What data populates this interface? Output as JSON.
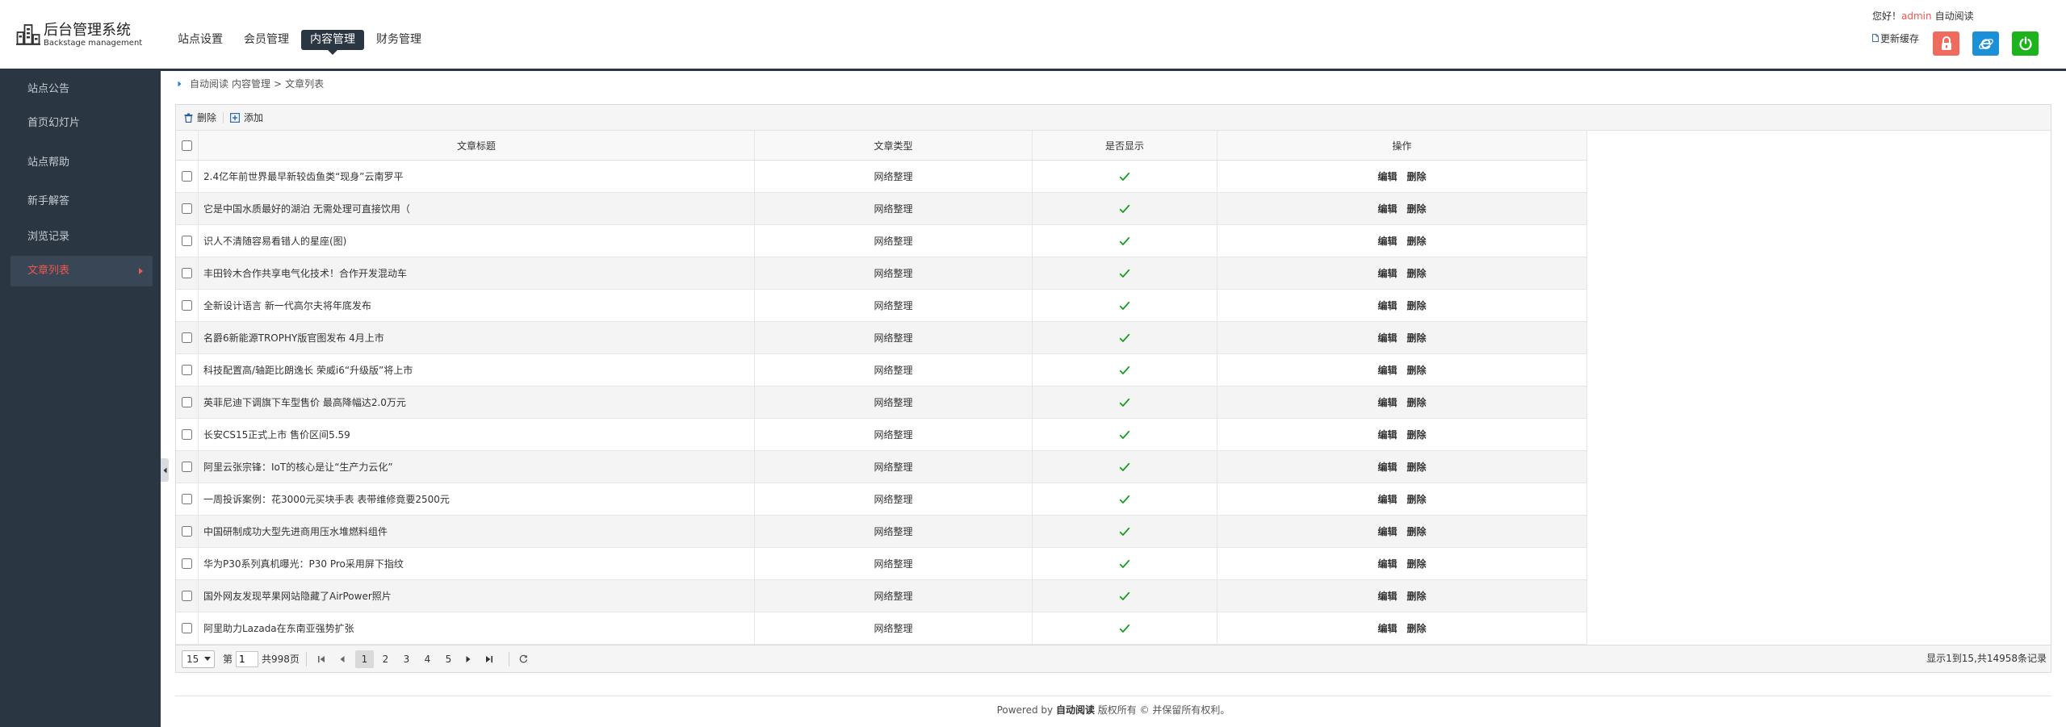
{
  "app": {
    "title": "后台管理系统",
    "subtitle": "Backstage management"
  },
  "nav": {
    "items": [
      {
        "label": "站点设置"
      },
      {
        "label": "会员管理"
      },
      {
        "label": "内容管理",
        "active": true
      },
      {
        "label": "财务管理"
      }
    ]
  },
  "user": {
    "greeting": "您好！",
    "name": "admin",
    "site": "自动阅读",
    "refresh_cache_label": "更新缓存"
  },
  "header_buttons": [
    {
      "icon": "lock-icon",
      "color": "#ee6b5e"
    },
    {
      "icon": "ie-icon",
      "color": "#1c8fd9"
    },
    {
      "icon": "power-icon",
      "color": "#1db31d"
    }
  ],
  "sidebar": {
    "items": [
      {
        "label": "站点公告"
      },
      {
        "label": "首页幻灯片"
      },
      {
        "label": "站点帮助"
      },
      {
        "label": "新手解答"
      },
      {
        "label": "浏览记录"
      },
      {
        "label": "文章列表",
        "active": true
      }
    ]
  },
  "breadcrumb": {
    "root": "自动阅读",
    "section": "内容管理",
    "separator": ">",
    "current": "文章列表"
  },
  "toolbar": {
    "delete_label": "删除",
    "add_label": "添加"
  },
  "table": {
    "columns": [
      "文章标题",
      "文章类型",
      "是否显示",
      "操作"
    ],
    "actions": {
      "edit": "编辑",
      "delete": "删除"
    },
    "rows": [
      {
        "title": "2.4亿年前世界最早新较齿鱼类“现身”云南罗平",
        "type": "网络整理",
        "shown": true
      },
      {
        "title": "它是中国水质最好的湖泊 无需处理可直接饮用（",
        "type": "网络整理",
        "shown": true
      },
      {
        "title": "识人不清随容易看错人的星座(图)",
        "type": "网络整理",
        "shown": true
      },
      {
        "title": "丰田铃木合作共享电气化技术！合作开发混动车",
        "type": "网络整理",
        "shown": true
      },
      {
        "title": "全新设计语言 新一代高尔夫将年底发布",
        "type": "网络整理",
        "shown": true
      },
      {
        "title": "名爵6新能源TROPHY版官图发布 4月上市",
        "type": "网络整理",
        "shown": true
      },
      {
        "title": "科技配置高/轴距比朗逸长 荣威i6“升级版”将上市",
        "type": "网络整理",
        "shown": true
      },
      {
        "title": "英菲尼迪下调旗下车型售价 最高降幅达2.0万元",
        "type": "网络整理",
        "shown": true
      },
      {
        "title": "长安CS15正式上市 售价区间5.59",
        "type": "网络整理",
        "shown": true
      },
      {
        "title": "阿里云张宗锋：IoT的核心是让“生产力云化”",
        "type": "网络整理",
        "shown": true
      },
      {
        "title": "一周投诉案例：花3000元买块手表 表带维修竟要2500元",
        "type": "网络整理",
        "shown": true
      },
      {
        "title": "中国研制成功大型先进商用压水堆燃料组件",
        "type": "网络整理",
        "shown": true
      },
      {
        "title": "华为P30系列真机曝光：P30 Pro采用屏下指纹",
        "type": "网络整理",
        "shown": true
      },
      {
        "title": "国外网友发现苹果网站隐藏了AirPower照片",
        "type": "网络整理",
        "shown": true
      },
      {
        "title": "阿里助力Lazada在东南亚强势扩张",
        "type": "网络整理",
        "shown": true
      }
    ]
  },
  "pagination": {
    "page_size": "15",
    "page_label": "第",
    "page_input": "1",
    "total_pages": "共998页",
    "pages": [
      {
        "label": "1",
        "active": true
      },
      {
        "label": "2"
      },
      {
        "label": "3"
      },
      {
        "label": "4"
      },
      {
        "label": "5"
      }
    ],
    "summary": "显示1到15,共14958条记录"
  },
  "footer": {
    "powered_by": "Powered by",
    "brand": "自动阅读",
    "copyright": "版权所有 © 并保留所有权利。"
  },
  "colors": {
    "accent": "#f0574f",
    "dark_navy": "#2b3643",
    "check": "#1a9b1a",
    "link_blue": "#2d6cb5"
  }
}
